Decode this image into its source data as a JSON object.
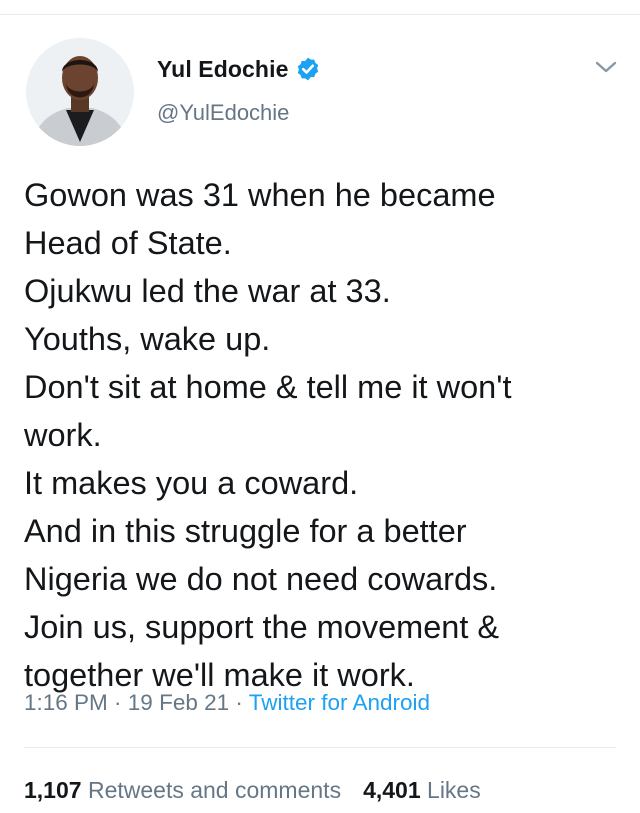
{
  "author": {
    "display_name": "Yul Edochie",
    "handle": "@YulEdochie",
    "verified": true
  },
  "tweet": {
    "lines": [
      "Gowon was 31 when he became",
      "Head of State.",
      "Ojukwu led the war at 33.",
      "Youths, wake up.",
      "Don't sit at home & tell me it won't",
      "work.",
      "It makes you a coward.",
      "And in this struggle for a better",
      "Nigeria we do not need cowards.",
      "Join us, support the movement &",
      "together we'll make it work."
    ]
  },
  "meta": {
    "time": "1:16 PM",
    "separator": " · ",
    "date": "19 Feb 21",
    "source": "Twitter for Android"
  },
  "stats": {
    "retweets_count": "1,107",
    "retweets_label": "Retweets and comments",
    "likes_count": "4,401",
    "likes_label": "Likes"
  },
  "icons": {
    "verified": "verified-badge-icon",
    "menu": "chevron-down-icon"
  },
  "colors": {
    "text": "#14171a",
    "secondary": "#657786",
    "accent": "#1da1f2",
    "divider": "#e6ecf0"
  }
}
